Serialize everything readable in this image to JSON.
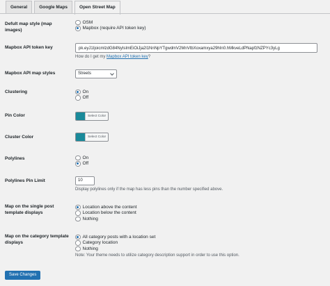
{
  "tabs": [
    {
      "label": "General"
    },
    {
      "label": "Google Maps"
    },
    {
      "label": "Open Street Map"
    }
  ],
  "map_style": {
    "label": "Defult map style (map images)",
    "options": [
      {
        "label": "OSM"
      },
      {
        "label": "Mapbox (require API token key)"
      }
    ],
    "selected": 1
  },
  "token": {
    "label": "Mapbox API token key",
    "value": "pk.eyJ1IjoicmlzdG84NyIsImEiOiJja2l1NnNpYTgwdmV2MnVtbXoxamxya29hIn0.hMkveLdPNapfzNZPYc3yLg",
    "help_prefix": "How do I get my ",
    "help_link": "Mapbox API token key",
    "help_suffix": "?"
  },
  "styles": {
    "label": "Mapbox API map styles",
    "value": "Streets"
  },
  "clustering": {
    "label": "Clustering",
    "options": [
      {
        "label": "On"
      },
      {
        "label": "Off"
      }
    ],
    "selected": 0
  },
  "pin_color": {
    "label": "Pin Color",
    "button": "Select Color",
    "color": "#1a8a9a"
  },
  "cluster_color": {
    "label": "Cluster Color",
    "button": "Select Color",
    "color": "#1a8a9a"
  },
  "polylines": {
    "label": "Polylines",
    "options": [
      {
        "label": "On"
      },
      {
        "label": "Off"
      }
    ],
    "selected": 1
  },
  "pin_limit": {
    "label": "Polylines Pin Limit",
    "value": "10",
    "desc": "Display polylines only if the map has less pins than the number specified above."
  },
  "single_post": {
    "label": "Map on the single post template displays",
    "options": [
      {
        "label": "Location above the content"
      },
      {
        "label": "Location below the content"
      },
      {
        "label": "Nothing"
      }
    ],
    "selected": 0
  },
  "category": {
    "label": "Map on the category template displays",
    "options": [
      {
        "label": "All category posts with a location set"
      },
      {
        "label": "Category location"
      },
      {
        "label": "Nothing"
      }
    ],
    "selected": 0,
    "note": "Note: Your theme needs to utilize category description support in order to use this option."
  },
  "save": {
    "label": "Save Changes"
  },
  "colors": {
    "accent": "#2271b1",
    "background": "#f1f1f1"
  }
}
